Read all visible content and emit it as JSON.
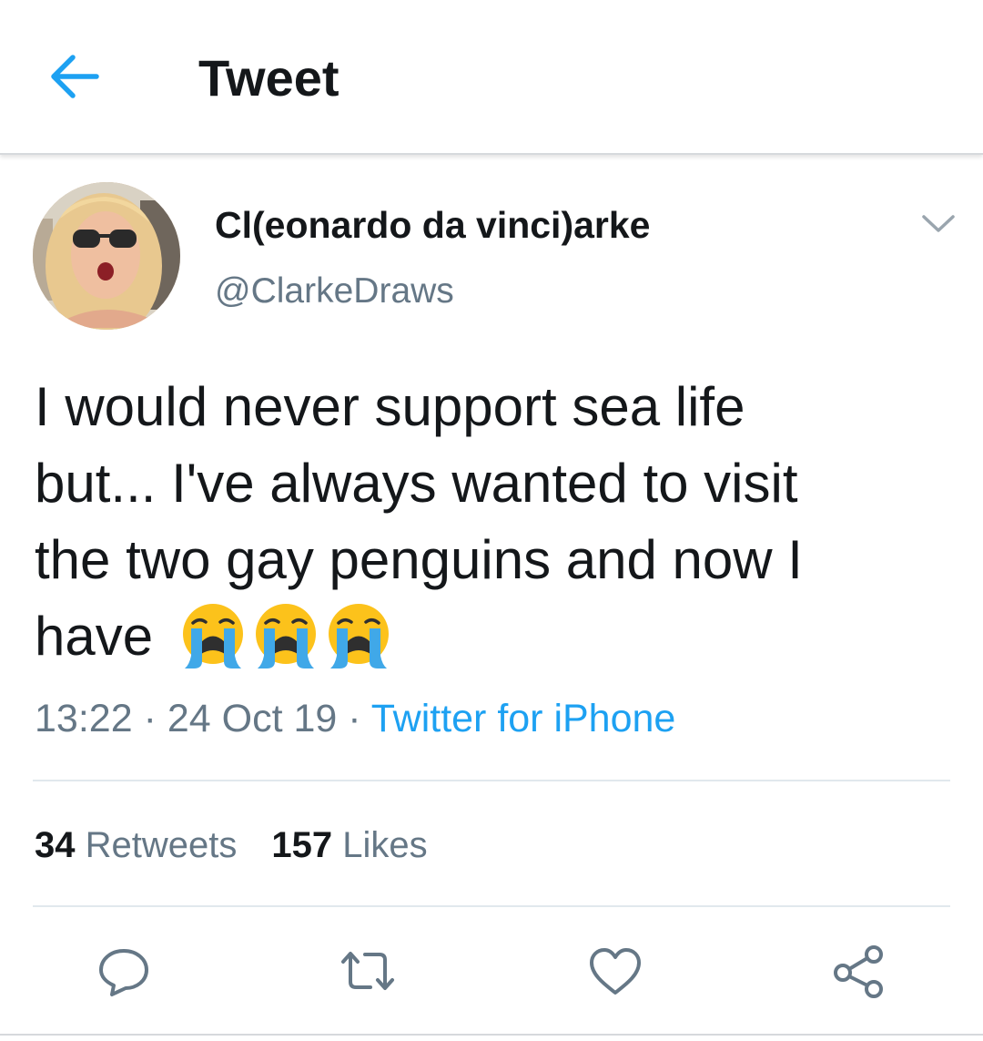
{
  "header": {
    "title": "Tweet",
    "back_icon": "arrow-left-icon"
  },
  "colors": {
    "accent": "#1da1f2",
    "text_primary": "#14171a",
    "text_secondary": "#657786",
    "divider": "#e1e8ed"
  },
  "tweet": {
    "display_name": "Cl(eonardo da vinci)arke",
    "handle": "@ClarkeDraws",
    "text_lines": [
      "I would never support sea life",
      "but... I've always wanted to visit",
      "the two gay penguins and now I",
      "have"
    ],
    "emojis": [
      "loudly-crying-face",
      "loudly-crying-face",
      "loudly-crying-face"
    ],
    "time": "13:22",
    "date": "24 Oct 19",
    "separator": "·",
    "source": "Twitter for iPhone"
  },
  "stats": {
    "retweets_count": "34",
    "retweets_label": "Retweets",
    "likes_count": "157",
    "likes_label": "Likes"
  },
  "actions": [
    "reply-icon",
    "retweet-icon",
    "like-icon",
    "share-icon"
  ]
}
